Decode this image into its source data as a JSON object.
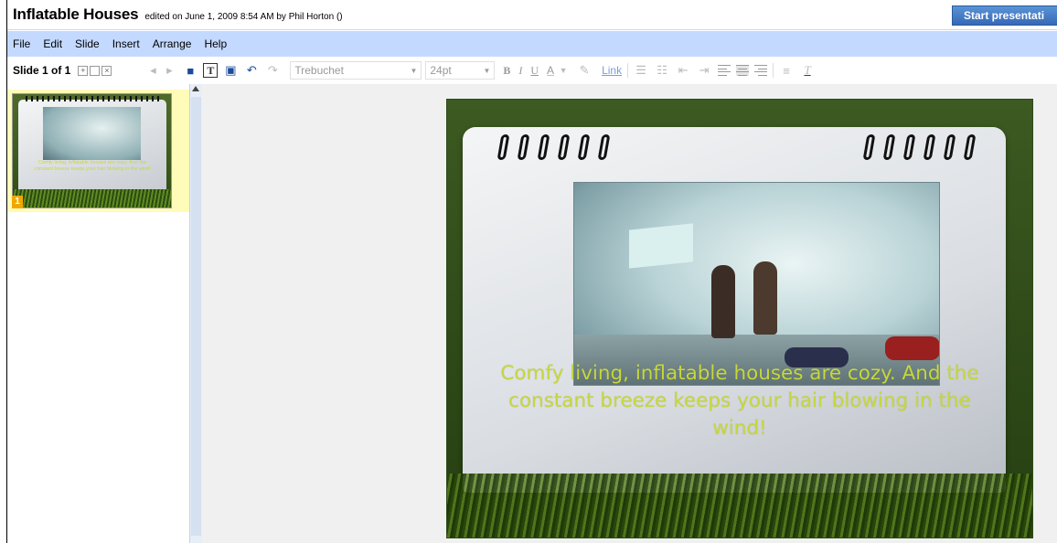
{
  "app": {
    "doc_title": "Inflatable Houses",
    "edited_info": "edited on June 1, 2009 8:54 AM by Phil Horton ()",
    "start_button": "Start presentati"
  },
  "menu": {
    "items": [
      "File",
      "Edit",
      "Slide",
      "Insert",
      "Arrange",
      "Help"
    ]
  },
  "toolbar": {
    "slide_count": "Slide 1 of 1",
    "font_name": "Trebuchet",
    "font_size": "24pt",
    "bold": "B",
    "italic": "I",
    "underline": "U",
    "text_color": "A",
    "link": "Link",
    "icons": [
      "add-slide-icon",
      "duplicate-slide-icon",
      "delete-slide-icon",
      "move-up-icon",
      "move-down-icon",
      "save-icon",
      "textbox-icon",
      "image-icon",
      "undo-icon",
      "redo-icon",
      "highlight-icon",
      "numbered-list-icon",
      "bulleted-list-icon",
      "indent-less-icon",
      "indent-more-icon",
      "align-left-icon",
      "align-center-icon",
      "align-right-icon",
      "line-spacing-icon",
      "clear-format-icon"
    ]
  },
  "slides": [
    {
      "number": "1",
      "caption": "Comfy living, inflatable houses are cozy. And the constant breeze keeps your hair blowing in the wind!"
    }
  ],
  "colors": {
    "caption": "#c7d83a",
    "menubar": "#c3d9ff",
    "start_button": "#3d7cc9",
    "selected_thumb": "#fffbb8"
  }
}
